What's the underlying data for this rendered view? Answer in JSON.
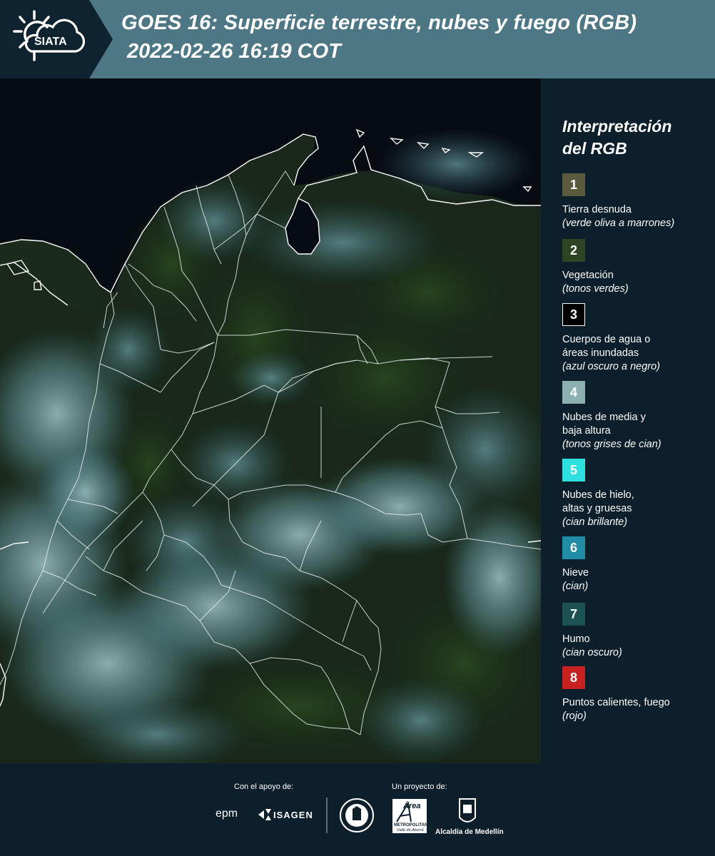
{
  "header": {
    "logo_text": "SIATA",
    "title_line1": "GOES 16: Superficie terrestre, nubes y fuego (RGB)",
    "title_line2": "2022-02-26 16:19 COT",
    "background_color": "#4d7785",
    "logo_panel_color": "#0f2230"
  },
  "legend": {
    "title_line1": "Interpretación",
    "title_line2": "del RGB",
    "items": [
      {
        "number": "1",
        "label_line1": "Tierra desnuda",
        "label_line2": "",
        "sub": "(verde oliva a marrones)",
        "color": "#5b5a3f"
      },
      {
        "number": "2",
        "label_line1": "Vegetación",
        "label_line2": "",
        "sub": "(tonos verdes)",
        "color": "#2f4422"
      },
      {
        "number": "3",
        "label_line1": "Cuerpos de agua o",
        "label_line2": "áreas inundadas",
        "sub": "(azul oscuro a negro)",
        "color": "#000000"
      },
      {
        "number": "4",
        "label_line1": "Nubes de media y",
        "label_line2": "baja altura",
        "sub": "(tonos grises de cian)",
        "color": "#8db0b0"
      },
      {
        "number": "5",
        "label_line1": "Nubes de hielo,",
        "label_line2": "altas y gruesas",
        "sub": "(cian brillante)",
        "color": "#2ee0e0"
      },
      {
        "number": "6",
        "label_line1": "Nieve",
        "label_line2": "",
        "sub": "(cian)",
        "color": "#1f8da5"
      },
      {
        "number": "7",
        "label_line1": "Humo",
        "label_line2": "",
        "sub": "(cian oscuro)",
        "color": "#1d5252"
      },
      {
        "number": "8",
        "label_line1": "Puntos calientes, fuego",
        "label_line2": "",
        "sub": "(rojo)",
        "color": "#c62020"
      }
    ]
  },
  "footer": {
    "support_caption": "Con el apoyo de:",
    "project_caption": "Un proyecto de:",
    "sponsors": {
      "epm": "epm",
      "isagen": "ISAGEN",
      "area_metro": "Área",
      "area_metro_sub1": "METROPOLITANA",
      "area_metro_sub2": "Valle de Aburrá",
      "alcaldia": "Alcaldía de Medellín"
    }
  }
}
